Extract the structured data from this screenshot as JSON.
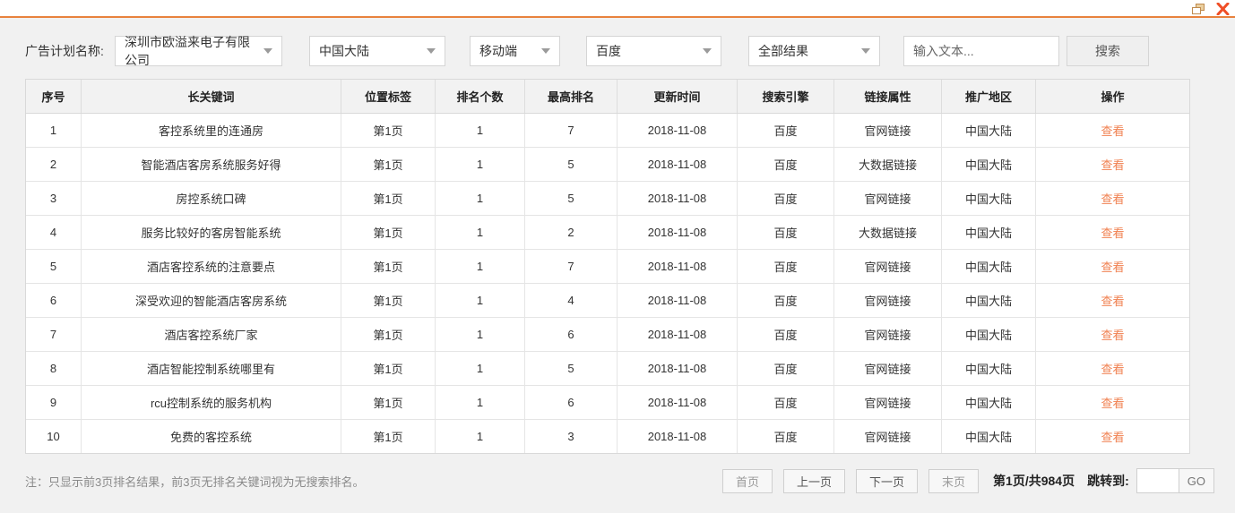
{
  "window": {
    "accent_color": "#e8823d",
    "close_color": "#ef4e26",
    "restore_color": "#bf8b4f"
  },
  "filters": {
    "label": "广告计划名称:",
    "plan_select": "深圳市欧溢来电子有限公司",
    "region_select": "中国大陆",
    "device_select": "移动端",
    "engine_select": "百度",
    "result_select": "全部结果",
    "search_placeholder": "输入文本...",
    "search_button": "搜索"
  },
  "table": {
    "headers": [
      "序号",
      "长关键词",
      "位置标签",
      "排名个数",
      "最高排名",
      "更新时间",
      "搜索引擎",
      "链接属性",
      "推广地区",
      "操作"
    ],
    "rows": [
      {
        "no": "1",
        "keyword": "客控系统里的连通房",
        "page": "第1页",
        "count": "1",
        "best": "7",
        "updated": "2018-11-08",
        "engine": "百度",
        "link_type": "官网链接",
        "region": "中国大陆",
        "action": "查看"
      },
      {
        "no": "2",
        "keyword": "智能酒店客房系统服务好得",
        "page": "第1页",
        "count": "1",
        "best": "5",
        "updated": "2018-11-08",
        "engine": "百度",
        "link_type": "大数据链接",
        "region": "中国大陆",
        "action": "查看"
      },
      {
        "no": "3",
        "keyword": "房控系统口碑",
        "page": "第1页",
        "count": "1",
        "best": "5",
        "updated": "2018-11-08",
        "engine": "百度",
        "link_type": "官网链接",
        "region": "中国大陆",
        "action": "查看"
      },
      {
        "no": "4",
        "keyword": "服务比较好的客房智能系统",
        "page": "第1页",
        "count": "1",
        "best": "2",
        "updated": "2018-11-08",
        "engine": "百度",
        "link_type": "大数据链接",
        "region": "中国大陆",
        "action": "查看"
      },
      {
        "no": "5",
        "keyword": "酒店客控系统的注意要点",
        "page": "第1页",
        "count": "1",
        "best": "7",
        "updated": "2018-11-08",
        "engine": "百度",
        "link_type": "官网链接",
        "region": "中国大陆",
        "action": "查看"
      },
      {
        "no": "6",
        "keyword": "深受欢迎的智能酒店客房系统",
        "page": "第1页",
        "count": "1",
        "best": "4",
        "updated": "2018-11-08",
        "engine": "百度",
        "link_type": "官网链接",
        "region": "中国大陆",
        "action": "查看"
      },
      {
        "no": "7",
        "keyword": "酒店客控系统厂家",
        "page": "第1页",
        "count": "1",
        "best": "6",
        "updated": "2018-11-08",
        "engine": "百度",
        "link_type": "官网链接",
        "region": "中国大陆",
        "action": "查看"
      },
      {
        "no": "8",
        "keyword": "酒店智能控制系统哪里有",
        "page": "第1页",
        "count": "1",
        "best": "5",
        "updated": "2018-11-08",
        "engine": "百度",
        "link_type": "官网链接",
        "region": "中国大陆",
        "action": "查看"
      },
      {
        "no": "9",
        "keyword": "rcu控制系统的服务机构",
        "page": "第1页",
        "count": "1",
        "best": "6",
        "updated": "2018-11-08",
        "engine": "百度",
        "link_type": "官网链接",
        "region": "中国大陆",
        "action": "查看"
      },
      {
        "no": "10",
        "keyword": "免费的客控系统",
        "page": "第1页",
        "count": "1",
        "best": "3",
        "updated": "2018-11-08",
        "engine": "百度",
        "link_type": "官网链接",
        "region": "中国大陆",
        "action": "查看"
      }
    ]
  },
  "footer": {
    "note": "注：只显示前3页排名结果，前3页无排名关键词视为无搜索排名。",
    "pagination": {
      "first": "首页",
      "prev": "上一页",
      "next": "下一页",
      "last": "末页",
      "page_info": "第1页/共984页",
      "jump_label": "跳转到:",
      "jump_value": "",
      "go": "GO"
    }
  }
}
